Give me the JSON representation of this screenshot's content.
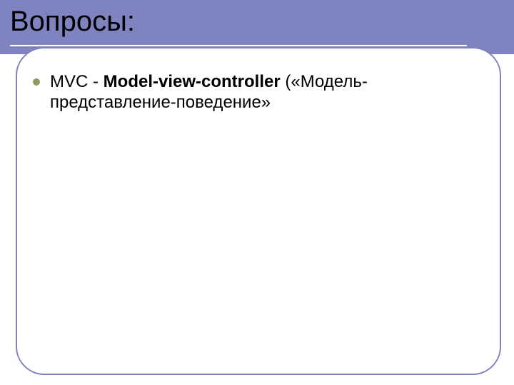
{
  "slide": {
    "title": "Вопросы:"
  },
  "bullet": {
    "prefix": "MVC  - ",
    "bold": "Model-view-controller",
    "suffix": " («Модель-представление-поведение»"
  },
  "colors": {
    "band": "#7f83c0",
    "bullet_dot": "#8d9b5b"
  }
}
